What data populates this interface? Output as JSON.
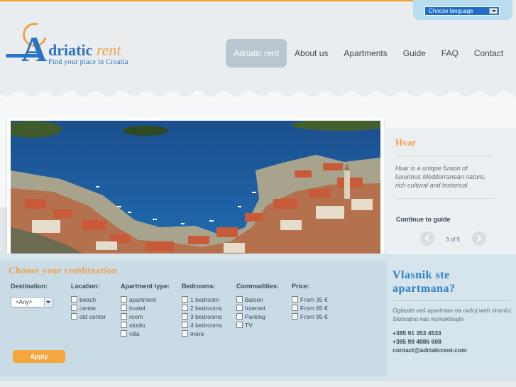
{
  "header": {
    "language_select": "Choose language",
    "logo": {
      "name_main": "driatic",
      "name_accent": "rent",
      "letter": "A",
      "tagline": "Find your place in Croatia"
    },
    "nav": [
      {
        "label": "Adriatic rent",
        "active": true
      },
      {
        "label": "About us",
        "active": false
      },
      {
        "label": "Apartments",
        "active": false
      },
      {
        "label": "Guide",
        "active": false
      },
      {
        "label": "FAQ",
        "active": false
      },
      {
        "label": "Contact",
        "active": false
      }
    ]
  },
  "slideshow": {
    "title": "Hvar",
    "description": "Hvar is a unique fusion of luxurious Mediterranean nature, rich cultural and historical",
    "link": "Continue to guide",
    "counter": "3 of 5"
  },
  "search": {
    "title": "Choose your combination",
    "destination": {
      "header": "Destination:",
      "value": "<Any>"
    },
    "location": {
      "header": "Location:",
      "options": [
        "beach",
        "center",
        "old center"
      ]
    },
    "apartment_type": {
      "header": "Apartment type:",
      "options": [
        "apartment",
        "hostel",
        "room",
        "studio",
        "villa"
      ]
    },
    "bedrooms": {
      "header": "Bedrooms:",
      "options": [
        "1 bedroom",
        "2 bedrooms",
        "3 bedrooms",
        "4 bedrooms",
        "more"
      ]
    },
    "commodities": {
      "header": "Commodities:",
      "options": [
        "Balcon",
        "Internet",
        "Parking",
        "TV"
      ]
    },
    "price": {
      "header": "Price:",
      "options": [
        "From 35 €",
        "From 65 €",
        "From 95 €"
      ]
    },
    "apply": "Apply"
  },
  "owner": {
    "title": "Vlasnik ste apartmana?",
    "text": "Oglasite vaš apartman na našoj web stranici. Slobodno nas kontaktirajte",
    "phone1": "+385 91 353 4533",
    "phone2": "+385 99 4886 608",
    "email": "contact@adriaticrent.com"
  },
  "colors": {
    "accent": "#f0a14a",
    "brand_blue": "#2b73c4",
    "nav_active": "#b9c6cf"
  }
}
